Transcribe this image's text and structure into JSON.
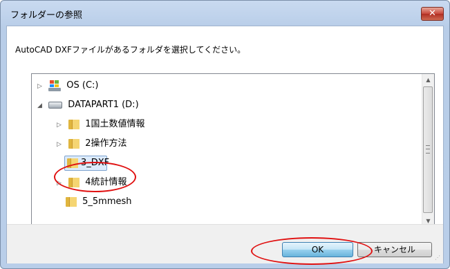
{
  "window": {
    "title": "フォルダーの参照",
    "close_label": "✕"
  },
  "instruction": "AutoCAD DXFファイルがあるフォルダを選択してください。",
  "tree": {
    "items": [
      {
        "label": "OS (C:)",
        "icon": "windows-drive-icon",
        "expander": "▷"
      },
      {
        "label": "DATAPART1 (D:)",
        "icon": "hard-drive-icon",
        "expander": "◢"
      },
      {
        "label": "1国土数値情報",
        "icon": "folder-icon",
        "expander": "▷"
      },
      {
        "label": "2操作方法",
        "icon": "folder-icon",
        "expander": "▷"
      },
      {
        "label": "3_DXF",
        "icon": "folder-icon",
        "expander": "",
        "selected": true
      },
      {
        "label": "4統計情報",
        "icon": "folder-icon",
        "expander": "▷"
      },
      {
        "label": "5_5mmesh",
        "icon": "folder-icon",
        "expander": ""
      }
    ]
  },
  "scrollbar": {
    "up": "▲",
    "down": "▼"
  },
  "buttons": {
    "ok": "OK",
    "cancel": "キャンセル"
  },
  "colors": {
    "highlight_ellipse": "#e01010",
    "selection": "#dcebfc"
  }
}
